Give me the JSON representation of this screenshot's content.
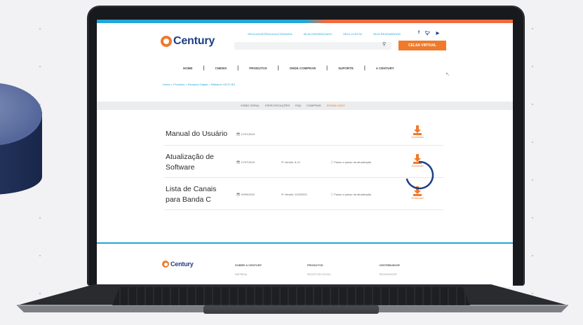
{
  "brand": {
    "name": "Century",
    "color": "#1d3d86",
    "accent": "#f07a2a",
    "link": "#23a6d9"
  },
  "header": {
    "top_links": [
      "SEJA ASSISTÊNCIA AUTORIZADA",
      "SEJA CREDENCIADO",
      "SEJA LOJISTA",
      "SEJA REVENDEDOR"
    ],
    "social_icons": [
      "facebook-icon",
      "twitter-icon",
      "youtube-icon"
    ],
    "search": {
      "placeholder": "",
      "icon": "search-icon"
    },
    "cta_label": "CELSA VIRTUAL"
  },
  "nav": {
    "items": [
      "HOME",
      "CNEWS",
      "PRODUTOS",
      "ONDE COMPRAR",
      "SUPORTE",
      "A CENTURY"
    ]
  },
  "breadcrumb": {
    "text": "Home > Produtos > Receptor Digital > Midiabox HDTV B3"
  },
  "tabs": {
    "items": [
      "VISÃO GERAL",
      "ESPECIFICAÇÕES",
      "FAQ",
      "COMPRAR",
      "DOWNLOADS"
    ],
    "active": "DOWNLOADS"
  },
  "downloads": [
    {
      "title_line1": "Manual do Usuário",
      "title_line2": "",
      "date": "17/07/2019",
      "version": "",
      "note": "",
      "button": "Download"
    },
    {
      "title_line1": "Atualização de",
      "title_line2": "Software",
      "date": "17/07/2019",
      "version": "Versão: 8.21",
      "note": "Passo a passo da atualização",
      "button": "Download"
    },
    {
      "title_line1": "Lista de Canais",
      "title_line2": "para Banda C",
      "date": "19/09/2022",
      "version": "Versão: 20220921",
      "note": "Passo a passo da atualização",
      "button": "Download"
    }
  ],
  "footer": {
    "logo": "Century",
    "columns": [
      {
        "title": "SOBRE A CENTURY",
        "sub": "EMPRESA"
      },
      {
        "title": "PRODUTOS",
        "sub": "RECEPTOR DIGITAL"
      },
      {
        "title": "DISTRIBUIDOR",
        "sub": "REVENDEDOR"
      }
    ]
  }
}
